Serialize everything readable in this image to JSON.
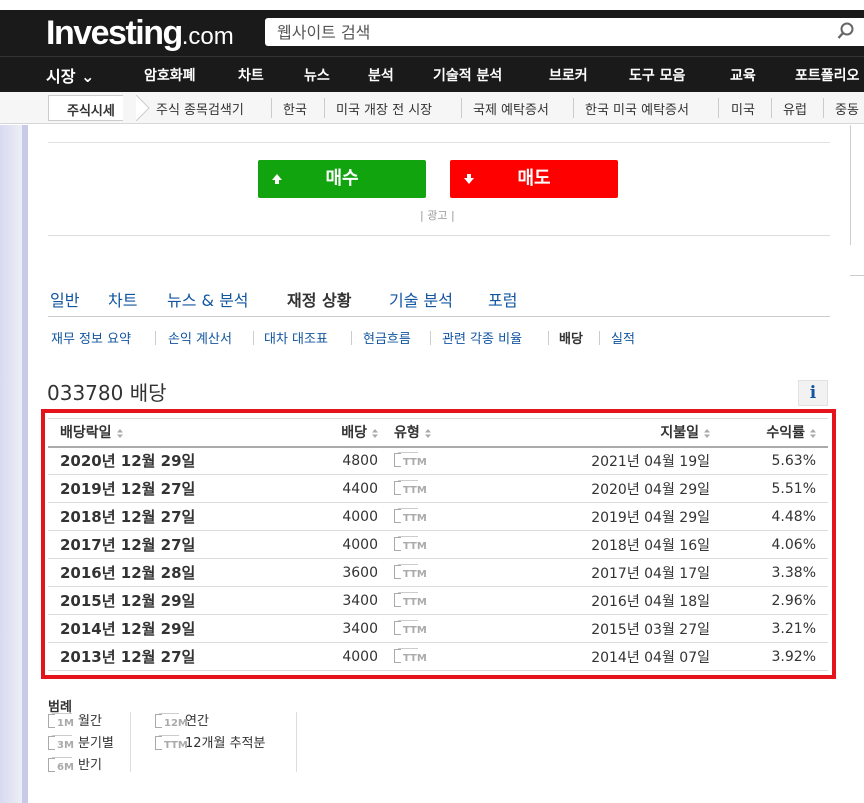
{
  "header": {
    "logo_main": "Investing",
    "logo_suffix": ".com",
    "search_placeholder": "웹사이트 검색"
  },
  "main_nav": [
    "시장 ⌄",
    "암호화폐",
    "차트",
    "뉴스",
    "분석",
    "기술적 분석",
    "브로커",
    "도구 모음",
    "교육",
    "포트폴리오"
  ],
  "sub_nav": {
    "active": "주식시세",
    "items": [
      "주식 종목검색기",
      "한국",
      "미국 개장 전 시장",
      "국제 예탁증서",
      "한국 미국 예탁증서",
      "미국",
      "유럽",
      "중동"
    ]
  },
  "buttons": {
    "buy": "매수",
    "sell": "매도",
    "ad": "| 광고 |"
  },
  "tabs": [
    {
      "label": "일반",
      "active": false
    },
    {
      "label": "차트",
      "active": false
    },
    {
      "label": "뉴스 & 분석",
      "active": false
    },
    {
      "label": "재정 상황",
      "active": true
    },
    {
      "label": "기술 분석",
      "active": false
    },
    {
      "label": "포럼",
      "active": false
    }
  ],
  "subtabs": [
    {
      "label": "재무 정보 요약",
      "active": false
    },
    {
      "label": "손익 계산서",
      "active": false
    },
    {
      "label": "대차 대조표",
      "active": false
    },
    {
      "label": "현금흐름",
      "active": false
    },
    {
      "label": "관련 각종 비율",
      "active": false
    },
    {
      "label": "배당",
      "active": true
    },
    {
      "label": "실적",
      "active": false
    }
  ],
  "page_title": "033780 배당",
  "info_icon": "i",
  "table": {
    "headers": {
      "ex_date": "배당락일",
      "dividend": "배당",
      "type": "유형",
      "pay_date": "지불일",
      "yield": "수익률"
    },
    "rows": [
      {
        "ex_date": "2020년 12월 29일",
        "dividend": "4800",
        "type": "TTM",
        "pay_date": "2021년 04월 19일",
        "yield": "5.63%"
      },
      {
        "ex_date": "2019년 12월 27일",
        "dividend": "4400",
        "type": "TTM",
        "pay_date": "2020년 04월 29일",
        "yield": "5.51%"
      },
      {
        "ex_date": "2018년 12월 27일",
        "dividend": "4000",
        "type": "TTM",
        "pay_date": "2019년 04월 29일",
        "yield": "4.48%"
      },
      {
        "ex_date": "2017년 12월 27일",
        "dividend": "4000",
        "type": "TTM",
        "pay_date": "2018년 04월 16일",
        "yield": "4.06%"
      },
      {
        "ex_date": "2016년 12월 28일",
        "dividend": "3600",
        "type": "TTM",
        "pay_date": "2017년 04월 17일",
        "yield": "3.38%"
      },
      {
        "ex_date": "2015년 12월 29일",
        "dividend": "3400",
        "type": "TTM",
        "pay_date": "2016년 04월 18일",
        "yield": "2.96%"
      },
      {
        "ex_date": "2014년 12월 29일",
        "dividend": "3400",
        "type": "TTM",
        "pay_date": "2015년 03월 27일",
        "yield": "3.21%"
      },
      {
        "ex_date": "2013년 12월 27일",
        "dividend": "4000",
        "type": "TTM",
        "pay_date": "2014년 04월 07일",
        "yield": "3.92%"
      }
    ]
  },
  "legend": {
    "title": "범례",
    "items": [
      {
        "tag": "1M",
        "label": "월간"
      },
      {
        "tag": "3M",
        "label": "분기별"
      },
      {
        "tag": "6M",
        "label": "반기"
      },
      {
        "tag": "12M",
        "label": "연간"
      },
      {
        "tag": "TTM",
        "label": "12개월 추적분"
      }
    ]
  },
  "colors": {
    "buy": "#12a40f",
    "sell": "#ff0000",
    "highlight": "#e4141d",
    "link": "#1256a0",
    "header_bg": "#1a1a1a"
  }
}
